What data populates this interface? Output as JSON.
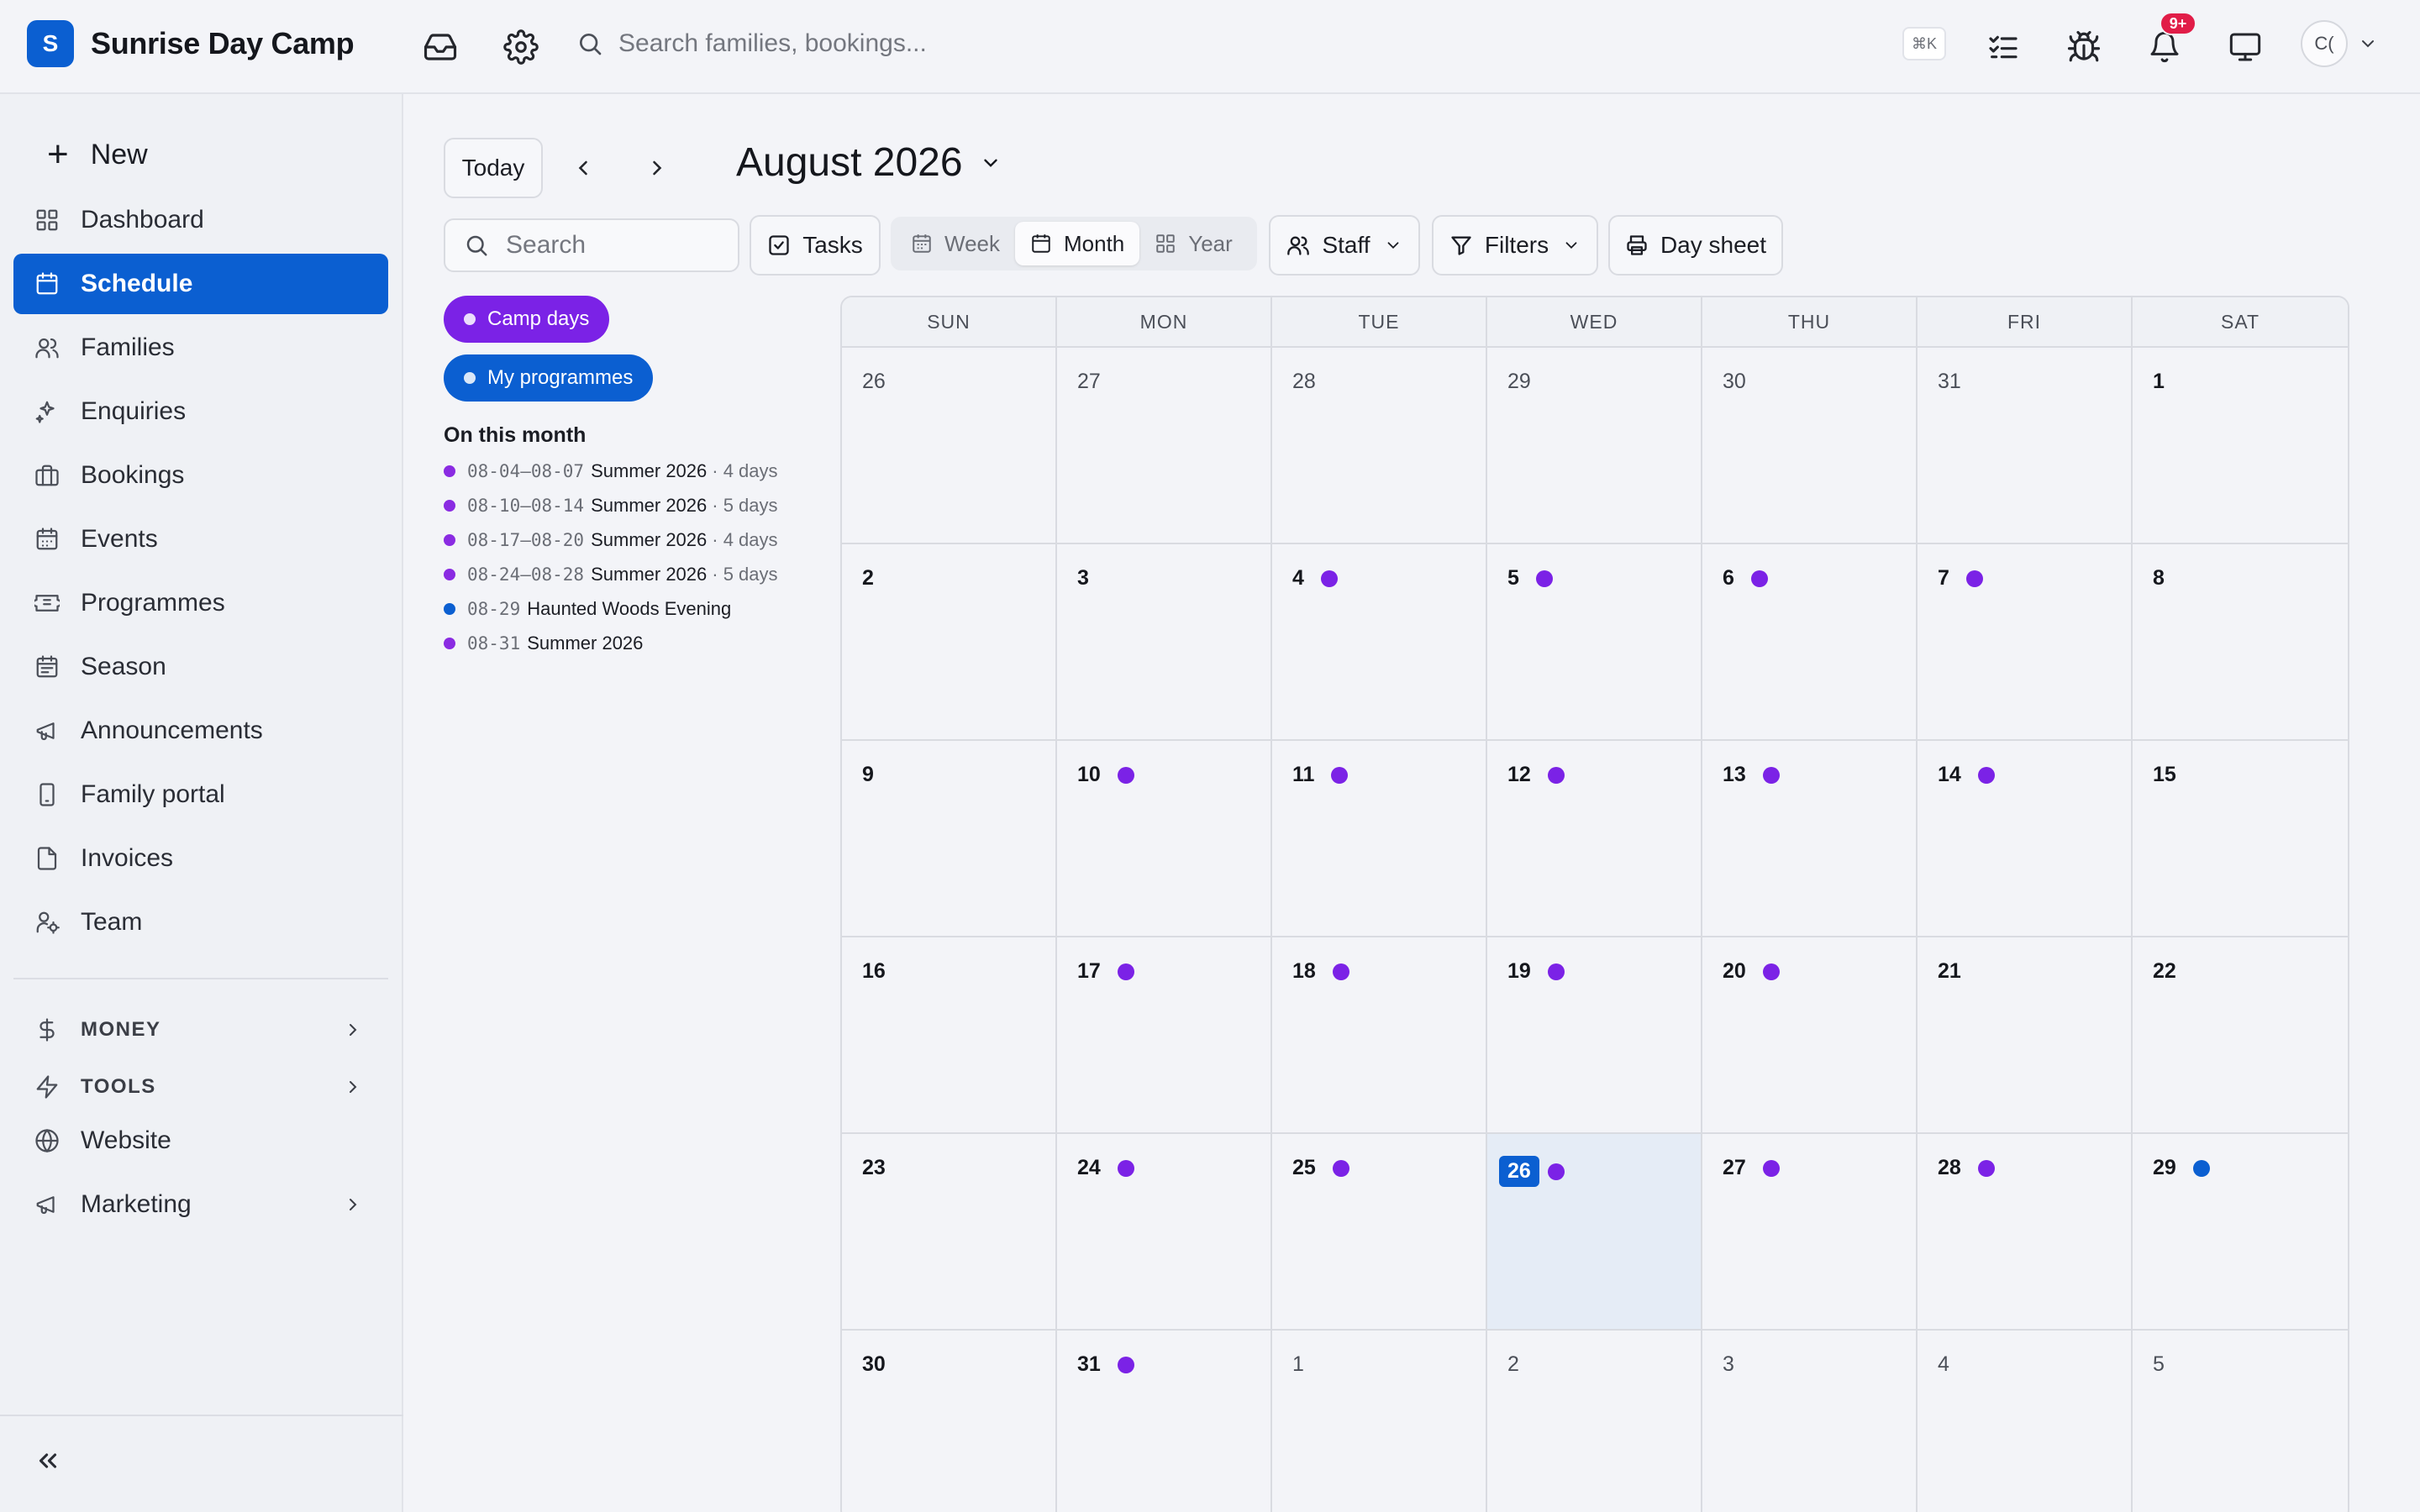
{
  "app": {
    "logo_letter": "S",
    "name": "Sunrise Day Camp",
    "search_placeholder": "Search families, bookings...",
    "shortcut": "⌘K",
    "notification_badge": "9+",
    "avatar_initials": "C("
  },
  "sidebar": {
    "new_label": "New",
    "items": [
      {
        "label": "Dashboard",
        "icon": "dashboard-icon"
      },
      {
        "label": "Schedule",
        "icon": "calendar-icon",
        "active": true
      },
      {
        "label": "Families",
        "icon": "users-icon"
      },
      {
        "label": "Enquiries",
        "icon": "sparkles-icon"
      },
      {
        "label": "Bookings",
        "icon": "briefcase-icon"
      },
      {
        "label": "Events",
        "icon": "calendar-events-icon"
      },
      {
        "label": "Programmes",
        "icon": "ticket-icon"
      },
      {
        "label": "Season",
        "icon": "calendar-season-icon"
      },
      {
        "label": "Announcements",
        "icon": "megaphone-icon"
      },
      {
        "label": "Family portal",
        "icon": "phone-icon"
      },
      {
        "label": "Invoices",
        "icon": "invoice-icon"
      },
      {
        "label": "Team",
        "icon": "team-icon"
      }
    ],
    "sections": [
      {
        "label": "MONEY",
        "icon": "dollar-icon"
      },
      {
        "label": "TOOLS",
        "icon": "bolt-icon"
      }
    ],
    "website_label": "Website",
    "marketing_label": "Marketing"
  },
  "toolbar": {
    "today_label": "Today",
    "month_title": "August 2026",
    "search_placeholder": "Search",
    "tasks_label": "Tasks",
    "views": [
      "Week",
      "Month",
      "Year"
    ],
    "active_view": "Month",
    "staff_label": "Staff",
    "filters_label": "Filters",
    "day_sheet_label": "Day sheet"
  },
  "legend": {
    "camp_days": "Camp days",
    "my_programmes": "My programmes",
    "camp_color": "#7b22e6",
    "programme_color": "#0b5fd1"
  },
  "on_this_month": {
    "title": "On this month",
    "items": [
      {
        "dates": "08-04–08-07",
        "name": "Summer 2026",
        "duration": "· 4 days",
        "color": "#8a2be2"
      },
      {
        "dates": "08-10–08-14",
        "name": "Summer 2026",
        "duration": "· 5 days",
        "color": "#8a2be2"
      },
      {
        "dates": "08-17–08-20",
        "name": "Summer 2026",
        "duration": "· 4 days",
        "color": "#8a2be2"
      },
      {
        "dates": "08-24–08-28",
        "name": "Summer 2026",
        "duration": "· 5 days",
        "color": "#8a2be2"
      },
      {
        "dates": "08-29",
        "name": "Haunted Woods Evening",
        "duration": "",
        "color": "#0b5fd1"
      },
      {
        "dates": "08-31",
        "name": "Summer 2026",
        "duration": "",
        "color": "#8a2be2"
      }
    ]
  },
  "calendar": {
    "weekdays": [
      "SUN",
      "MON",
      "TUE",
      "WED",
      "THU",
      "FRI",
      "SAT"
    ],
    "today": "26",
    "weeks": [
      [
        {
          "d": "26",
          "m": 1
        },
        {
          "d": "27",
          "m": 1
        },
        {
          "d": "28",
          "m": 1
        },
        {
          "d": "29",
          "m": 1
        },
        {
          "d": "30",
          "m": 1
        },
        {
          "d": "31",
          "m": 1
        },
        {
          "d": "1"
        }
      ],
      [
        {
          "d": "2"
        },
        {
          "d": "3"
        },
        {
          "d": "4",
          "e": "camp"
        },
        {
          "d": "5",
          "e": "camp"
        },
        {
          "d": "6",
          "e": "camp"
        },
        {
          "d": "7",
          "e": "camp"
        },
        {
          "d": "8"
        }
      ],
      [
        {
          "d": "9"
        },
        {
          "d": "10",
          "e": "camp"
        },
        {
          "d": "11",
          "e": "camp"
        },
        {
          "d": "12",
          "e": "camp"
        },
        {
          "d": "13",
          "e": "camp"
        },
        {
          "d": "14",
          "e": "camp"
        },
        {
          "d": "15"
        }
      ],
      [
        {
          "d": "16"
        },
        {
          "d": "17",
          "e": "camp"
        },
        {
          "d": "18",
          "e": "camp"
        },
        {
          "d": "19",
          "e": "camp"
        },
        {
          "d": "20",
          "e": "camp"
        },
        {
          "d": "21"
        },
        {
          "d": "22"
        }
      ],
      [
        {
          "d": "23"
        },
        {
          "d": "24",
          "e": "camp"
        },
        {
          "d": "25",
          "e": "camp"
        },
        {
          "d": "26",
          "e": "camp",
          "t": 1
        },
        {
          "d": "27",
          "e": "camp"
        },
        {
          "d": "28",
          "e": "camp"
        },
        {
          "d": "29",
          "e": "prog"
        }
      ],
      [
        {
          "d": "30"
        },
        {
          "d": "31",
          "e": "camp"
        },
        {
          "d": "1",
          "m": 1
        },
        {
          "d": "2",
          "m": 1
        },
        {
          "d": "3",
          "m": 1
        },
        {
          "d": "4",
          "m": 1
        },
        {
          "d": "5",
          "m": 1
        }
      ]
    ]
  }
}
